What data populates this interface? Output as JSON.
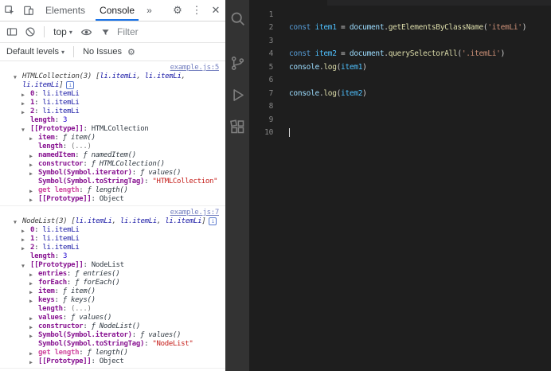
{
  "devtools": {
    "tab_bar": {
      "tabs": [
        {
          "label": "Elements",
          "active": false
        },
        {
          "label": "Console",
          "active": true
        }
      ],
      "more_tabs_glyph": "»",
      "right_icons": {
        "settings_glyph": "⚙",
        "more_glyph": "⋮",
        "close_glyph": "✕"
      }
    },
    "toolbar": {
      "context_selector": {
        "label": "top",
        "caret": "▾"
      },
      "filter": {
        "placeholder": "Filter"
      }
    },
    "levels_bar": {
      "default_levels": {
        "label": "Default levels",
        "caret": "▾"
      },
      "issues_label": "No Issues",
      "gear_glyph": "⚙"
    },
    "console": {
      "entries": [
        {
          "source_link": "example.js:5",
          "rows": [
            {
              "indent": 0,
              "arrow": "down",
              "info": true,
              "parts": [
                {
                  "c": "obj",
                  "t": "HTMLCollection(3) ["
                },
                {
                  "c": "nodei",
                  "t": "li.itemLi"
                },
                {
                  "c": "obj",
                  "t": ", "
                },
                {
                  "c": "nodei",
                  "t": "li.itemLi"
                },
                {
                  "c": "obj",
                  "t": ", "
                },
                {
                  "c": "nodei",
                  "t": "li.itemLi"
                },
                {
                  "c": "obj",
                  "t": "]"
                }
              ]
            },
            {
              "indent": 1,
              "arrow": "right",
              "parts": [
                {
                  "c": "key",
                  "t": "0"
                },
                {
                  "c": "plain",
                  "t": ": "
                },
                {
                  "c": "node",
                  "t": "li.itemLi"
                }
              ]
            },
            {
              "indent": 1,
              "arrow": "right",
              "parts": [
                {
                  "c": "key",
                  "t": "1"
                },
                {
                  "c": "plain",
                  "t": ": "
                },
                {
                  "c": "node",
                  "t": "li.itemLi"
                }
              ]
            },
            {
              "indent": 1,
              "arrow": "right",
              "parts": [
                {
                  "c": "key",
                  "t": "2"
                },
                {
                  "c": "plain",
                  "t": ": "
                },
                {
                  "c": "node",
                  "t": "li.itemLi"
                }
              ]
            },
            {
              "indent": 1,
              "arrow": null,
              "parts": [
                {
                  "c": "key",
                  "t": "length"
                },
                {
                  "c": "plain",
                  "t": ": "
                },
                {
                  "c": "num",
                  "t": "3"
                }
              ]
            },
            {
              "indent": 1,
              "arrow": "down",
              "parts": [
                {
                  "c": "key",
                  "t": "[[Prototype]]"
                },
                {
                  "c": "plain",
                  "t": ": "
                },
                {
                  "c": "plain",
                  "t": "HTMLCollection"
                }
              ]
            },
            {
              "indent": 2,
              "arrow": "right",
              "parts": [
                {
                  "c": "key",
                  "t": "item"
                },
                {
                  "c": "plain",
                  "t": ": "
                },
                {
                  "c": "fn",
                  "t": "ƒ item()"
                }
              ]
            },
            {
              "indent": 2,
              "arrow": null,
              "parts": [
                {
                  "c": "key",
                  "t": "length"
                },
                {
                  "c": "plain",
                  "t": ": "
                },
                {
                  "c": "dots",
                  "t": "(...)"
                }
              ]
            },
            {
              "indent": 2,
              "arrow": "right",
              "parts": [
                {
                  "c": "key",
                  "t": "namedItem"
                },
                {
                  "c": "plain",
                  "t": ": "
                },
                {
                  "c": "fn",
                  "t": "ƒ namedItem()"
                }
              ]
            },
            {
              "indent": 2,
              "arrow": "right",
              "parts": [
                {
                  "c": "key",
                  "t": "constructor"
                },
                {
                  "c": "plain",
                  "t": ": "
                },
                {
                  "c": "fn",
                  "t": "ƒ HTMLCollection()"
                }
              ]
            },
            {
              "indent": 2,
              "arrow": "right",
              "parts": [
                {
                  "c": "key",
                  "t": "Symbol(Symbol.iterator)"
                },
                {
                  "c": "plain",
                  "t": ": "
                },
                {
                  "c": "fn",
                  "t": "ƒ values()"
                }
              ]
            },
            {
              "indent": 2,
              "arrow": null,
              "parts": [
                {
                  "c": "key",
                  "t": "Symbol(Symbol.toStringTag)"
                },
                {
                  "c": "plain",
                  "t": ": "
                },
                {
                  "c": "str",
                  "t": "\"HTMLCollection\""
                }
              ]
            },
            {
              "indent": 2,
              "arrow": "right",
              "parts": [
                {
                  "c": "getkey",
                  "t": "get length"
                },
                {
                  "c": "plain",
                  "t": ": "
                },
                {
                  "c": "fn",
                  "t": "ƒ length()"
                }
              ]
            },
            {
              "indent": 2,
              "arrow": "right",
              "parts": [
                {
                  "c": "key",
                  "t": "[[Prototype]]"
                },
                {
                  "c": "plain",
                  "t": ": "
                },
                {
                  "c": "plain",
                  "t": "Object"
                }
              ]
            }
          ]
        },
        {
          "source_link": "example.js:7",
          "rows": [
            {
              "indent": 0,
              "arrow": "down",
              "info": true,
              "parts": [
                {
                  "c": "obj",
                  "t": "NodeList(3) ["
                },
                {
                  "c": "nodei",
                  "t": "li.itemLi"
                },
                {
                  "c": "obj",
                  "t": ", "
                },
                {
                  "c": "nodei",
                  "t": "li.itemLi"
                },
                {
                  "c": "obj",
                  "t": ", "
                },
                {
                  "c": "nodei",
                  "t": "li.itemLi"
                },
                {
                  "c": "obj",
                  "t": "]"
                }
              ]
            },
            {
              "indent": 1,
              "arrow": "right",
              "parts": [
                {
                  "c": "key",
                  "t": "0"
                },
                {
                  "c": "plain",
                  "t": ": "
                },
                {
                  "c": "node",
                  "t": "li.itemLi"
                }
              ]
            },
            {
              "indent": 1,
              "arrow": "right",
              "parts": [
                {
                  "c": "key",
                  "t": "1"
                },
                {
                  "c": "plain",
                  "t": ": "
                },
                {
                  "c": "node",
                  "t": "li.itemLi"
                }
              ]
            },
            {
              "indent": 1,
              "arrow": "right",
              "parts": [
                {
                  "c": "key",
                  "t": "2"
                },
                {
                  "c": "plain",
                  "t": ": "
                },
                {
                  "c": "node",
                  "t": "li.itemLi"
                }
              ]
            },
            {
              "indent": 1,
              "arrow": null,
              "parts": [
                {
                  "c": "key",
                  "t": "length"
                },
                {
                  "c": "plain",
                  "t": ": "
                },
                {
                  "c": "num",
                  "t": "3"
                }
              ]
            },
            {
              "indent": 1,
              "arrow": "down",
              "parts": [
                {
                  "c": "key",
                  "t": "[[Prototype]]"
                },
                {
                  "c": "plain",
                  "t": ": "
                },
                {
                  "c": "plain",
                  "t": "NodeList"
                }
              ]
            },
            {
              "indent": 2,
              "arrow": "right",
              "parts": [
                {
                  "c": "key",
                  "t": "entries"
                },
                {
                  "c": "plain",
                  "t": ": "
                },
                {
                  "c": "fn",
                  "t": "ƒ entries()"
                }
              ]
            },
            {
              "indent": 2,
              "arrow": "right",
              "parts": [
                {
                  "c": "key",
                  "t": "forEach"
                },
                {
                  "c": "plain",
                  "t": ": "
                },
                {
                  "c": "fn",
                  "t": "ƒ forEach()"
                }
              ]
            },
            {
              "indent": 2,
              "arrow": "right",
              "parts": [
                {
                  "c": "key",
                  "t": "item"
                },
                {
                  "c": "plain",
                  "t": ": "
                },
                {
                  "c": "fn",
                  "t": "ƒ item()"
                }
              ]
            },
            {
              "indent": 2,
              "arrow": "right",
              "parts": [
                {
                  "c": "key",
                  "t": "keys"
                },
                {
                  "c": "plain",
                  "t": ": "
                },
                {
                  "c": "fn",
                  "t": "ƒ keys()"
                }
              ]
            },
            {
              "indent": 2,
              "arrow": null,
              "parts": [
                {
                  "c": "key",
                  "t": "length"
                },
                {
                  "c": "plain",
                  "t": ": "
                },
                {
                  "c": "dots",
                  "t": "(...)"
                }
              ]
            },
            {
              "indent": 2,
              "arrow": "right",
              "parts": [
                {
                  "c": "key",
                  "t": "values"
                },
                {
                  "c": "plain",
                  "t": ": "
                },
                {
                  "c": "fn",
                  "t": "ƒ values()"
                }
              ]
            },
            {
              "indent": 2,
              "arrow": "right",
              "parts": [
                {
                  "c": "key",
                  "t": "constructor"
                },
                {
                  "c": "plain",
                  "t": ": "
                },
                {
                  "c": "fn",
                  "t": "ƒ NodeList()"
                }
              ]
            },
            {
              "indent": 2,
              "arrow": "right",
              "parts": [
                {
                  "c": "key",
                  "t": "Symbol(Symbol.iterator)"
                },
                {
                  "c": "plain",
                  "t": ": "
                },
                {
                  "c": "fn",
                  "t": "ƒ values()"
                }
              ]
            },
            {
              "indent": 2,
              "arrow": null,
              "parts": [
                {
                  "c": "key",
                  "t": "Symbol(Symbol.toStringTag)"
                },
                {
                  "c": "plain",
                  "t": ": "
                },
                {
                  "c": "str",
                  "t": "\"NodeList\""
                }
              ]
            },
            {
              "indent": 2,
              "arrow": "right",
              "parts": [
                {
                  "c": "getkey",
                  "t": "get length"
                },
                {
                  "c": "plain",
                  "t": ": "
                },
                {
                  "c": "fn",
                  "t": "ƒ length()"
                }
              ]
            },
            {
              "indent": 2,
              "arrow": "right",
              "parts": [
                {
                  "c": "key",
                  "t": "[[Prototype]]"
                },
                {
                  "c": "plain",
                  "t": ": "
                },
                {
                  "c": "plain",
                  "t": "Object"
                }
              ]
            }
          ]
        }
      ]
    }
  },
  "activity_bar": {
    "icons": [
      "search-icon",
      "source-control-icon",
      "run-debug-icon",
      "extensions-icon"
    ]
  },
  "editor": {
    "lines": [
      {
        "n": 1,
        "tokens": []
      },
      {
        "n": 2,
        "tokens": [
          {
            "c": "kw",
            "t": "const "
          },
          {
            "c": "cvar",
            "t": "item1"
          },
          {
            "c": "plain",
            "t": " = "
          },
          {
            "c": "dom",
            "t": "document"
          },
          {
            "c": "plain",
            "t": "."
          },
          {
            "c": "fn",
            "t": "getElementsByClassName"
          },
          {
            "c": "plain",
            "t": "("
          },
          {
            "c": "str",
            "t": "'itemLi'"
          },
          {
            "c": "plain",
            "t": ")"
          }
        ]
      },
      {
        "n": 3,
        "tokens": []
      },
      {
        "n": 4,
        "tokens": [
          {
            "c": "kw",
            "t": "const "
          },
          {
            "c": "cvar",
            "t": "item2"
          },
          {
            "c": "plain",
            "t": " = "
          },
          {
            "c": "dom",
            "t": "document"
          },
          {
            "c": "plain",
            "t": "."
          },
          {
            "c": "fn",
            "t": "querySelectorAll"
          },
          {
            "c": "plain",
            "t": "("
          },
          {
            "c": "str",
            "t": "'.itemLi'"
          },
          {
            "c": "plain",
            "t": ")"
          }
        ]
      },
      {
        "n": 5,
        "tokens": [
          {
            "c": "dom",
            "t": "console"
          },
          {
            "c": "plain",
            "t": "."
          },
          {
            "c": "fn",
            "t": "log"
          },
          {
            "c": "plain",
            "t": "("
          },
          {
            "c": "cvar",
            "t": "item1"
          },
          {
            "c": "plain",
            "t": ")"
          }
        ]
      },
      {
        "n": 6,
        "tokens": []
      },
      {
        "n": 7,
        "tokens": [
          {
            "c": "dom",
            "t": "console"
          },
          {
            "c": "plain",
            "t": "."
          },
          {
            "c": "fn",
            "t": "log"
          },
          {
            "c": "plain",
            "t": "("
          },
          {
            "c": "cvar",
            "t": "item2"
          },
          {
            "c": "plain",
            "t": ")"
          }
        ]
      },
      {
        "n": 8,
        "tokens": []
      },
      {
        "n": 9,
        "tokens": []
      },
      {
        "n": 10,
        "tokens": [],
        "cursor": true
      }
    ]
  }
}
